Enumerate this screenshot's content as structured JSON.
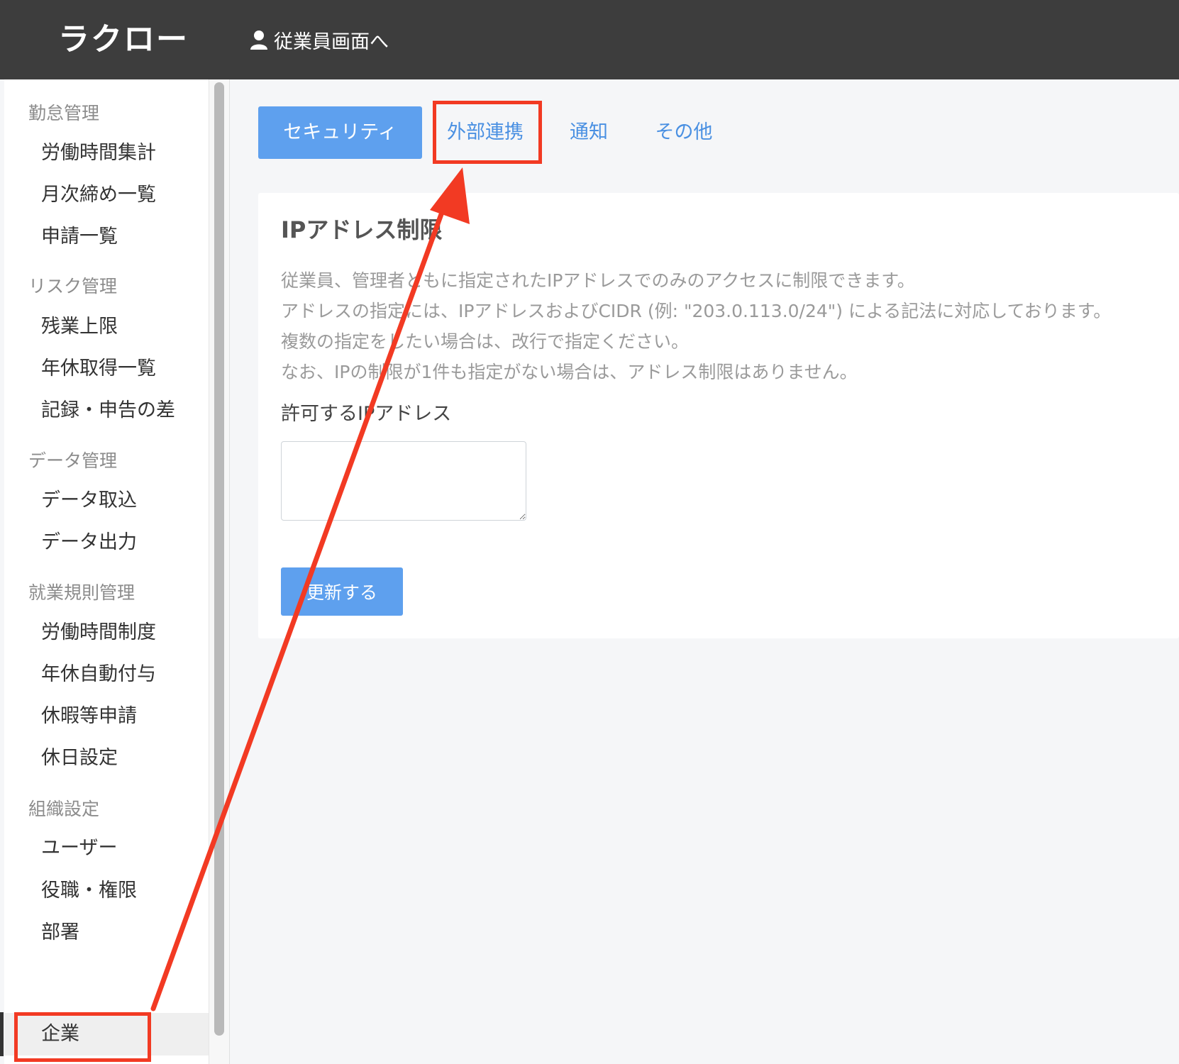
{
  "header": {
    "logo": "ラクロー",
    "employee_link": "従業員画面へ"
  },
  "sidebar": {
    "sections": [
      {
        "title": "勤怠管理",
        "items": [
          "労働時間集計",
          "月次締め一覧",
          "申請一覧"
        ]
      },
      {
        "title": "リスク管理",
        "items": [
          "残業上限",
          "年休取得一覧",
          "記録・申告の差"
        ]
      },
      {
        "title": "データ管理",
        "items": [
          "データ取込",
          "データ出力"
        ]
      },
      {
        "title": "就業規則管理",
        "items": [
          "労働時間制度",
          "年休自動付与",
          "休暇等申請",
          "休日設定"
        ]
      },
      {
        "title": "組織設定",
        "items": [
          "ユーザー",
          "役職・権限",
          "部署",
          "企業"
        ]
      }
    ],
    "active_item": "企業"
  },
  "tabs": [
    "セキュリティ",
    "外部連携",
    "通知",
    "その他"
  ],
  "active_tab": "セキュリティ",
  "panel": {
    "title": "IPアドレス制限",
    "description": [
      "従業員、管理者ともに指定されたIPアドレスでのみのアクセスに制限できます。",
      "アドレスの指定には、IPアドレスおよびCIDR (例: \"203.0.113.0/24\") による記法に対応しております。",
      "複数の指定をしたい場合は、改行で指定ください。",
      "なお、IPの制限が1件も指定がない場合は、アドレス制限はありません。"
    ],
    "field_label": "許可するIPアドレス",
    "field_value": "",
    "submit_label": "更新する"
  },
  "colors": {
    "header_bg": "#3d3d3d",
    "accent": "#5ea0ee",
    "link": "#4a90e2",
    "annotation": "#f23a23"
  }
}
